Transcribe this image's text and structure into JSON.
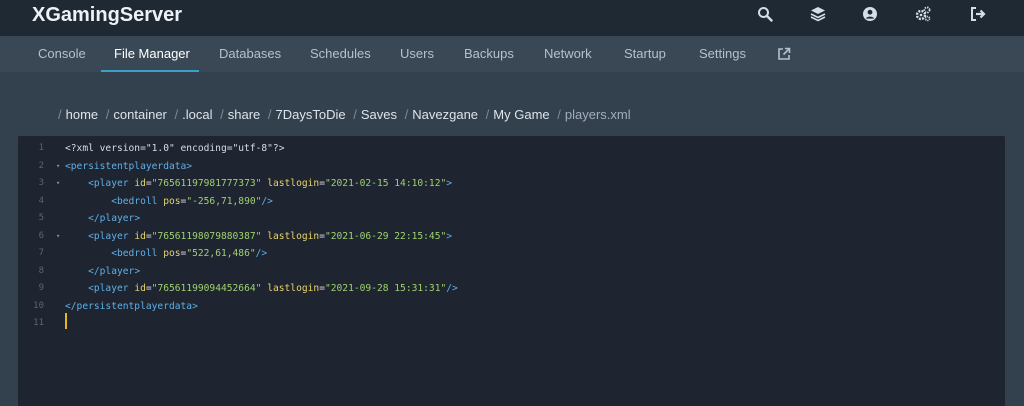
{
  "app": {
    "title": "XGamingServer"
  },
  "top_icons": [
    {
      "name": "search-icon"
    },
    {
      "name": "layers-icon"
    },
    {
      "name": "account-icon"
    },
    {
      "name": "cogs-icon"
    },
    {
      "name": "logout-icon"
    }
  ],
  "tabs": [
    {
      "label": "Console",
      "active": false
    },
    {
      "label": "File Manager",
      "active": true
    },
    {
      "label": "Databases",
      "active": false
    },
    {
      "label": "Schedules",
      "active": false
    },
    {
      "label": "Users",
      "active": false
    },
    {
      "label": "Backups",
      "active": false
    },
    {
      "label": "Network",
      "active": false
    },
    {
      "label": "Startup",
      "active": false
    },
    {
      "label": "Settings",
      "active": false
    }
  ],
  "tab_external_icon": "external-link-icon",
  "breadcrumb": {
    "separator": "/",
    "segments": [
      "home",
      "container",
      ".local",
      "share",
      "7DaysToDie",
      "Saves",
      "Navezgane",
      "My Game"
    ],
    "current": "players.xml"
  },
  "editor": {
    "lines": [
      {
        "num": "1",
        "fold": false,
        "indent": "",
        "tokens": [
          [
            "t-plain",
            "<?xml version=\"1.0\" encoding=\"utf-8\"?>"
          ]
        ]
      },
      {
        "num": "2",
        "fold": true,
        "indent": "",
        "tokens": [
          [
            "t-tag",
            "<persistentplayerdata>"
          ]
        ]
      },
      {
        "num": "3",
        "fold": true,
        "indent": "    ",
        "tokens": [
          [
            "t-tag",
            "<player "
          ],
          [
            "t-attr",
            "id"
          ],
          [
            "t-plain",
            "="
          ],
          [
            "t-val",
            "\"76561197981777373\""
          ],
          [
            "t-attr",
            " lastlogin"
          ],
          [
            "t-plain",
            "="
          ],
          [
            "t-val",
            "\"2021-02-15 14:10:12\""
          ],
          [
            "t-tag",
            ">"
          ]
        ]
      },
      {
        "num": "4",
        "fold": false,
        "indent": "        ",
        "tokens": [
          [
            "t-tag",
            "<bedroll "
          ],
          [
            "t-attr",
            "pos"
          ],
          [
            "t-plain",
            "="
          ],
          [
            "t-val",
            "\"-256,71,890\""
          ],
          [
            "t-tag",
            "/>"
          ]
        ]
      },
      {
        "num": "5",
        "fold": false,
        "indent": "    ",
        "tokens": [
          [
            "t-tag",
            "</player>"
          ]
        ]
      },
      {
        "num": "6",
        "fold": true,
        "indent": "    ",
        "tokens": [
          [
            "t-tag",
            "<player "
          ],
          [
            "t-attr",
            "id"
          ],
          [
            "t-plain",
            "="
          ],
          [
            "t-val",
            "\"76561198079880387\""
          ],
          [
            "t-attr",
            " lastlogin"
          ],
          [
            "t-plain",
            "="
          ],
          [
            "t-val",
            "\"2021-06-29 22:15:45\""
          ],
          [
            "t-tag",
            ">"
          ]
        ]
      },
      {
        "num": "7",
        "fold": false,
        "indent": "        ",
        "tokens": [
          [
            "t-tag",
            "<bedroll "
          ],
          [
            "t-attr",
            "pos"
          ],
          [
            "t-plain",
            "="
          ],
          [
            "t-val",
            "\"522,61,486\""
          ],
          [
            "t-tag",
            "/>"
          ]
        ]
      },
      {
        "num": "8",
        "fold": false,
        "indent": "    ",
        "tokens": [
          [
            "t-tag",
            "</player>"
          ]
        ]
      },
      {
        "num": "9",
        "fold": false,
        "indent": "    ",
        "tokens": [
          [
            "t-tag",
            "<player "
          ],
          [
            "t-attr",
            "id"
          ],
          [
            "t-plain",
            "="
          ],
          [
            "t-val",
            "\"76561199094452664\""
          ],
          [
            "t-attr",
            " lastlogin"
          ],
          [
            "t-plain",
            "="
          ],
          [
            "t-val",
            "\"2021-09-28 15:31:31\""
          ],
          [
            "t-tag",
            "/>"
          ]
        ]
      },
      {
        "num": "10",
        "fold": false,
        "indent": "",
        "tokens": [
          [
            "t-tag",
            "</persistentplayerdata>"
          ]
        ]
      },
      {
        "num": "11",
        "fold": false,
        "indent": "",
        "tokens": []
      }
    ]
  },
  "colors": {
    "topbar": "#1f2933",
    "subnav": "#3a4856",
    "background": "#33404d",
    "accent": "#3aa0c8",
    "editor_bg": "#1e2430",
    "tag": "#5fb0e8",
    "attribute": "#e8d36a",
    "value": "#9fd170",
    "cursor": "#e6b422"
  }
}
